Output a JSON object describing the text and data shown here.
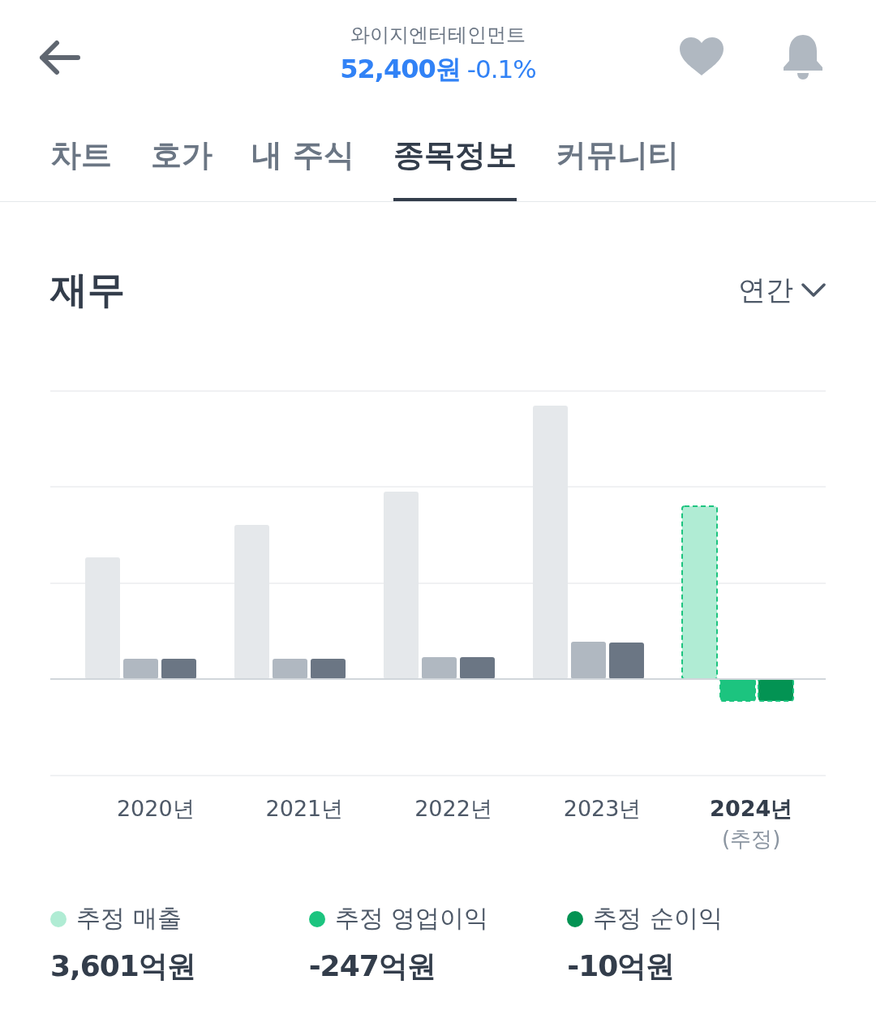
{
  "header": {
    "company": "와이지엔터테인먼트",
    "price": "52,400원",
    "change": "-0.1%"
  },
  "tabs": [
    {
      "label": "차트",
      "selected": false
    },
    {
      "label": "호가",
      "selected": false
    },
    {
      "label": "내 주식",
      "selected": false
    },
    {
      "label": "종목정보",
      "selected": true
    },
    {
      "label": "커뮤니티",
      "selected": false
    }
  ],
  "section": {
    "title": "재무",
    "period": "연간"
  },
  "chart": {
    "years": [
      {
        "label": "2020년",
        "kind": "actual"
      },
      {
        "label": "2021년",
        "kind": "actual"
      },
      {
        "label": "2022년",
        "kind": "actual"
      },
      {
        "label": "2023년",
        "kind": "actual"
      },
      {
        "label": "2024년",
        "note": "(추정)",
        "kind": "estimate"
      }
    ]
  },
  "legend": [
    {
      "label": "추정 매출",
      "value": "3,601억원",
      "color": "#b0ecd4"
    },
    {
      "label": "추정 영업이익",
      "value": "-247억원",
      "color": "#1cc47f"
    },
    {
      "label": "추정 순이익",
      "value": "-10억원",
      "color": "#039353"
    }
  ]
}
